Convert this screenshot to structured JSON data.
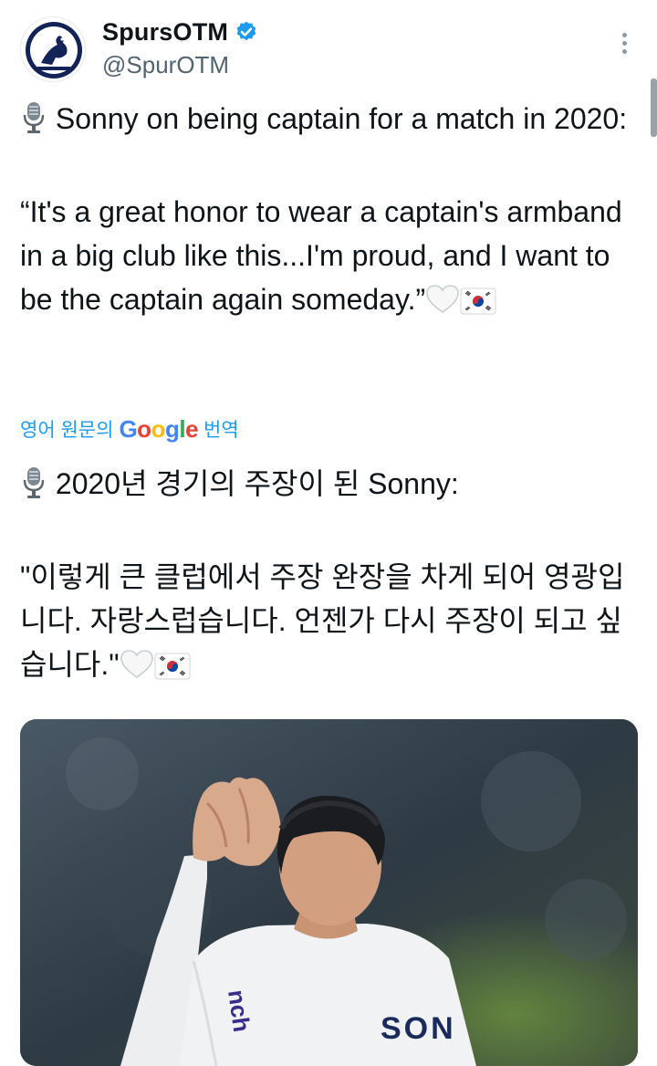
{
  "author": {
    "display_name": "SpursOTM",
    "handle": "@SpurOTM",
    "verified": true
  },
  "tweet": {
    "line_1": "Sonny on being captain for a match in 2020:",
    "quote": "“It's a great honor to wear a captain's armband in a big club like this...I'm proud, and I want to be the captain again someday.”"
  },
  "translate": {
    "prefix": "영어 원문의",
    "brand": "Google",
    "suffix": "번역"
  },
  "translated": {
    "line_1": "2020년 경기의 주장이 된 Sonny:",
    "quote": "\"이렇게 큰 클럽에서 주장 완장을 차게 되어 영광입니다. 자랑스럽습니다. 언젠가 다시 주장이 되고 싶습니다.\""
  },
  "media": {
    "jersey_name": "SON",
    "sponsor_text": "nch"
  },
  "icons": {
    "microphone": "microphone-icon",
    "heart": "white-heart-icon",
    "flag": "south-korea-flag-icon",
    "verified": "verified-badge-icon",
    "more": "more-options-icon"
  },
  "colors": {
    "text": "#0f1419",
    "secondary": "#536471",
    "link": "#1d9bf0",
    "verified": "#1d9bf0"
  }
}
